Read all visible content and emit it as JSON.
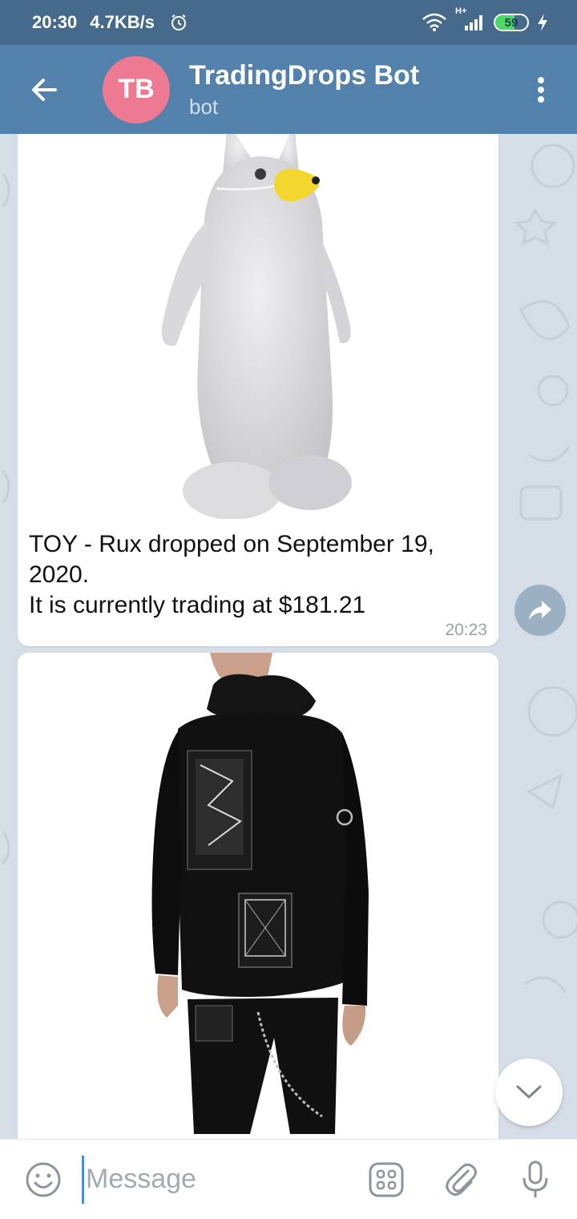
{
  "status_bar": {
    "time": "20:30",
    "speed": "4.7KB/s",
    "network": "H+",
    "battery": "59"
  },
  "header": {
    "avatar_initials": "TB",
    "title": "TradingDrops Bot",
    "subtitle": "bot"
  },
  "messages": [
    {
      "caption_line1": "TOY - Rux dropped on September 19, 2020.",
      "caption_line2": "It is currently trading at $181.21",
      "time": "20:23"
    }
  ],
  "input": {
    "placeholder": "Message"
  },
  "colors": {
    "header": "#5281ab",
    "status_bar": "#456a8c",
    "avatar": "#ee7a91",
    "chat_bg": "#d5dde6"
  }
}
